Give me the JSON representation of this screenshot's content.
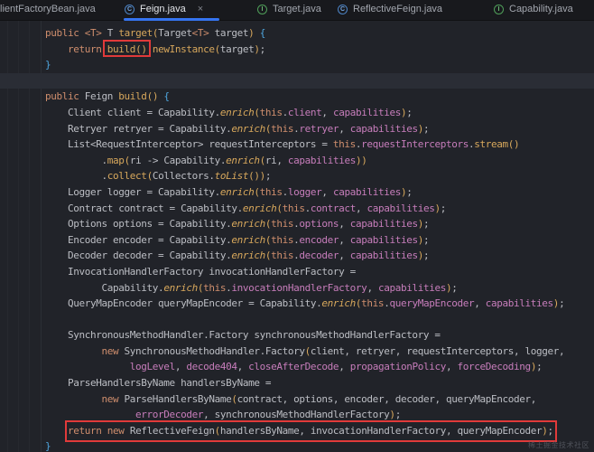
{
  "tabs": {
    "items": [
      {
        "label": "lientFactoryBean.java",
        "icon": "none",
        "active": false,
        "closable": false
      },
      {
        "label": "Feign.java",
        "icon": "class",
        "active": true,
        "closable": true
      },
      {
        "label": "Target.java",
        "icon": "interface",
        "active": false,
        "closable": false
      },
      {
        "label": "ReflectiveFeign.java",
        "icon": "class",
        "active": false,
        "closable": false
      },
      {
        "label": "Capability.java",
        "icon": "interface",
        "active": false,
        "closable": false
      }
    ],
    "class_icon_letter": "C",
    "interface_icon_letter": "I",
    "close_glyph": "×"
  },
  "colors": {
    "active_tab_indicator": "#3574f0",
    "annotation_red": "#e03a3a",
    "editor_background": "#212329",
    "caret_line": "#2a2d35",
    "keyword": "#cf8e6d",
    "method": "#d8a85c",
    "field": "#c77dbb",
    "brace": "#4fa7e0",
    "text": "#bcbec4"
  },
  "watermark": {
    "text": "稀土掘金技术社区"
  },
  "code": {
    "lines": [
      {
        "indent": 0,
        "caret": false,
        "tokens": [
          [
            "k",
            "public "
          ],
          [
            "g",
            "<T>"
          ],
          [
            "d",
            " T "
          ],
          [
            "m",
            "target"
          ],
          [
            "p",
            "("
          ],
          [
            "d",
            "Target"
          ],
          [
            "g",
            "<T>"
          ],
          [
            "d",
            " target"
          ],
          [
            "p",
            ")"
          ],
          [
            "d",
            " "
          ],
          [
            "b",
            "{"
          ]
        ]
      },
      {
        "indent": 4,
        "caret": false,
        "tokens": [
          [
            "k",
            "return "
          ],
          [
            "m",
            "build"
          ],
          [
            "p",
            "()"
          ],
          [
            "d",
            "."
          ],
          [
            "m",
            "newInstance"
          ],
          [
            "p",
            "("
          ],
          [
            "d",
            "target"
          ],
          [
            "p",
            ")"
          ],
          [
            "d",
            ";"
          ]
        ]
      },
      {
        "indent": 0,
        "caret": false,
        "tokens": [
          [
            "b",
            "}"
          ]
        ]
      },
      {
        "indent": 0,
        "caret": true,
        "tokens": []
      },
      {
        "indent": 0,
        "caret": false,
        "tokens": [
          [
            "k",
            "public "
          ],
          [
            "d",
            "Feign "
          ],
          [
            "m",
            "build"
          ],
          [
            "p",
            "()"
          ],
          [
            "d",
            " "
          ],
          [
            "b",
            "{"
          ]
        ]
      },
      {
        "indent": 4,
        "caret": false,
        "tokens": [
          [
            "d",
            "Client client = Capability."
          ],
          [
            "i",
            "enrich"
          ],
          [
            "p",
            "("
          ],
          [
            "k",
            "this"
          ],
          [
            "d",
            "."
          ],
          [
            "f",
            "client"
          ],
          [
            "d",
            ", "
          ],
          [
            "f",
            "capabilities"
          ],
          [
            "p",
            ")"
          ],
          [
            "d",
            ";"
          ]
        ]
      },
      {
        "indent": 4,
        "caret": false,
        "tokens": [
          [
            "d",
            "Retryer retryer = Capability."
          ],
          [
            "i",
            "enrich"
          ],
          [
            "p",
            "("
          ],
          [
            "k",
            "this"
          ],
          [
            "d",
            "."
          ],
          [
            "f",
            "retryer"
          ],
          [
            "d",
            ", "
          ],
          [
            "f",
            "capabilities"
          ],
          [
            "p",
            ")"
          ],
          [
            "d",
            ";"
          ]
        ]
      },
      {
        "indent": 4,
        "caret": false,
        "tokens": [
          [
            "d",
            "List<RequestInterceptor> requestInterceptors = "
          ],
          [
            "k",
            "this"
          ],
          [
            "d",
            "."
          ],
          [
            "f",
            "requestInterceptors"
          ],
          [
            "d",
            "."
          ],
          [
            "m",
            "stream"
          ],
          [
            "p",
            "()"
          ]
        ]
      },
      {
        "indent": 10,
        "caret": false,
        "tokens": [
          [
            "d",
            "."
          ],
          [
            "m",
            "map"
          ],
          [
            "p",
            "("
          ],
          [
            "d",
            "ri -> Capability."
          ],
          [
            "i",
            "enrich"
          ],
          [
            "p",
            "("
          ],
          [
            "d",
            "ri, "
          ],
          [
            "f",
            "capabilities"
          ],
          [
            "p",
            "))"
          ]
        ]
      },
      {
        "indent": 10,
        "caret": false,
        "tokens": [
          [
            "d",
            "."
          ],
          [
            "m",
            "collect"
          ],
          [
            "p",
            "("
          ],
          [
            "d",
            "Collectors."
          ],
          [
            "i",
            "toList"
          ],
          [
            "p",
            "())"
          ],
          [
            "d",
            ";"
          ]
        ]
      },
      {
        "indent": 4,
        "caret": false,
        "tokens": [
          [
            "d",
            "Logger logger = Capability."
          ],
          [
            "i",
            "enrich"
          ],
          [
            "p",
            "("
          ],
          [
            "k",
            "this"
          ],
          [
            "d",
            "."
          ],
          [
            "f",
            "logger"
          ],
          [
            "d",
            ", "
          ],
          [
            "f",
            "capabilities"
          ],
          [
            "p",
            ")"
          ],
          [
            "d",
            ";"
          ]
        ]
      },
      {
        "indent": 4,
        "caret": false,
        "tokens": [
          [
            "d",
            "Contract contract = Capability."
          ],
          [
            "i",
            "enrich"
          ],
          [
            "p",
            "("
          ],
          [
            "k",
            "this"
          ],
          [
            "d",
            "."
          ],
          [
            "f",
            "contract"
          ],
          [
            "d",
            ", "
          ],
          [
            "f",
            "capabilities"
          ],
          [
            "p",
            ")"
          ],
          [
            "d",
            ";"
          ]
        ]
      },
      {
        "indent": 4,
        "caret": false,
        "tokens": [
          [
            "d",
            "Options options = Capability."
          ],
          [
            "i",
            "enrich"
          ],
          [
            "p",
            "("
          ],
          [
            "k",
            "this"
          ],
          [
            "d",
            "."
          ],
          [
            "f",
            "options"
          ],
          [
            "d",
            ", "
          ],
          [
            "f",
            "capabilities"
          ],
          [
            "p",
            ")"
          ],
          [
            "d",
            ";"
          ]
        ]
      },
      {
        "indent": 4,
        "caret": false,
        "tokens": [
          [
            "d",
            "Encoder encoder = Capability."
          ],
          [
            "i",
            "enrich"
          ],
          [
            "p",
            "("
          ],
          [
            "k",
            "this"
          ],
          [
            "d",
            "."
          ],
          [
            "f",
            "encoder"
          ],
          [
            "d",
            ", "
          ],
          [
            "f",
            "capabilities"
          ],
          [
            "p",
            ")"
          ],
          [
            "d",
            ";"
          ]
        ]
      },
      {
        "indent": 4,
        "caret": false,
        "tokens": [
          [
            "d",
            "Decoder decoder = Capability."
          ],
          [
            "i",
            "enrich"
          ],
          [
            "p",
            "("
          ],
          [
            "k",
            "this"
          ],
          [
            "d",
            "."
          ],
          [
            "f",
            "decoder"
          ],
          [
            "d",
            ", "
          ],
          [
            "f",
            "capabilities"
          ],
          [
            "p",
            ")"
          ],
          [
            "d",
            ";"
          ]
        ]
      },
      {
        "indent": 4,
        "caret": false,
        "tokens": [
          [
            "d",
            "InvocationHandlerFactory invocationHandlerFactory ="
          ]
        ]
      },
      {
        "indent": 10,
        "caret": false,
        "tokens": [
          [
            "d",
            "Capability."
          ],
          [
            "i",
            "enrich"
          ],
          [
            "p",
            "("
          ],
          [
            "k",
            "this"
          ],
          [
            "d",
            "."
          ],
          [
            "f",
            "invocationHandlerFactory"
          ],
          [
            "d",
            ", "
          ],
          [
            "f",
            "capabilities"
          ],
          [
            "p",
            ")"
          ],
          [
            "d",
            ";"
          ]
        ]
      },
      {
        "indent": 4,
        "caret": false,
        "tokens": [
          [
            "d",
            "QueryMapEncoder queryMapEncoder = Capability."
          ],
          [
            "i",
            "enrich"
          ],
          [
            "p",
            "("
          ],
          [
            "k",
            "this"
          ],
          [
            "d",
            "."
          ],
          [
            "f",
            "queryMapEncoder"
          ],
          [
            "d",
            ", "
          ],
          [
            "f",
            "capabilities"
          ],
          [
            "p",
            ")"
          ],
          [
            "d",
            ";"
          ]
        ]
      },
      {
        "indent": 0,
        "caret": false,
        "tokens": []
      },
      {
        "indent": 4,
        "caret": false,
        "tokens": [
          [
            "d",
            "SynchronousMethodHandler.Factory synchronousMethodHandlerFactory ="
          ]
        ]
      },
      {
        "indent": 10,
        "caret": false,
        "tokens": [
          [
            "k",
            "new "
          ],
          [
            "d",
            "SynchronousMethodHandler.Factory"
          ],
          [
            "p",
            "("
          ],
          [
            "d",
            "client, retryer, requestInterceptors, logger,"
          ]
        ]
      },
      {
        "indent": 15,
        "caret": false,
        "tokens": [
          [
            "f",
            "logLevel"
          ],
          [
            "d",
            ", "
          ],
          [
            "f",
            "decode404"
          ],
          [
            "d",
            ", "
          ],
          [
            "f",
            "closeAfterDecode"
          ],
          [
            "d",
            ", "
          ],
          [
            "f",
            "propagationPolicy"
          ],
          [
            "d",
            ", "
          ],
          [
            "f",
            "forceDecoding"
          ],
          [
            "p",
            ")"
          ],
          [
            "d",
            ";"
          ]
        ]
      },
      {
        "indent": 4,
        "caret": false,
        "tokens": [
          [
            "d",
            "ParseHandlersByName handlersByName ="
          ]
        ]
      },
      {
        "indent": 10,
        "caret": false,
        "tokens": [
          [
            "k",
            "new "
          ],
          [
            "d",
            "ParseHandlersByName"
          ],
          [
            "p",
            "("
          ],
          [
            "d",
            "contract, options, encoder, decoder, queryMapEncoder,"
          ]
        ]
      },
      {
        "indent": 16,
        "caret": false,
        "tokens": [
          [
            "f",
            "errorDecoder"
          ],
          [
            "d",
            ", synchronousMethodHandlerFactory"
          ],
          [
            "p",
            ")"
          ],
          [
            "d",
            ";"
          ]
        ]
      },
      {
        "indent": 4,
        "caret": false,
        "tokens": [
          [
            "k",
            "return "
          ],
          [
            "k",
            "new "
          ],
          [
            "d",
            "ReflectiveFeign"
          ],
          [
            "p",
            "("
          ],
          [
            "d",
            "handlersByName, invocationHandlerFactory, queryMapEncoder"
          ],
          [
            "p",
            ")"
          ],
          [
            "d",
            ";"
          ]
        ]
      },
      {
        "indent": 0,
        "caret": false,
        "tokens": [
          [
            "b",
            "}"
          ]
        ]
      }
    ]
  }
}
